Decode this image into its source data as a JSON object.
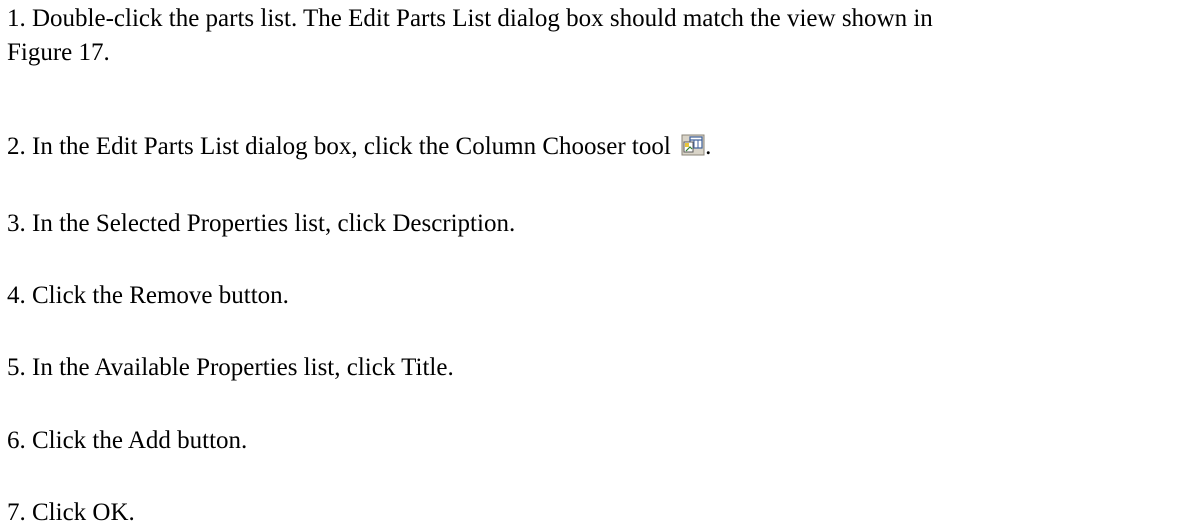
{
  "steps": {
    "step1_line1": "1. Double-click the parts list. The Edit Parts List dialog box should match the view shown in",
    "step1_line2": "Figure 17.",
    "step2_before": "2. In the Edit Parts List dialog box, click the Column Chooser tool",
    "step2_after": ".",
    "step3": "3. In the Selected Properties list, click Description.",
    "step4": "4. Click the Remove button.",
    "step5": "5. In the Available Properties list, click Title.",
    "step6": "6. Click the Add button.",
    "step7": "7. Click OK."
  },
  "icons": {
    "column_chooser": "column-chooser-icon"
  }
}
